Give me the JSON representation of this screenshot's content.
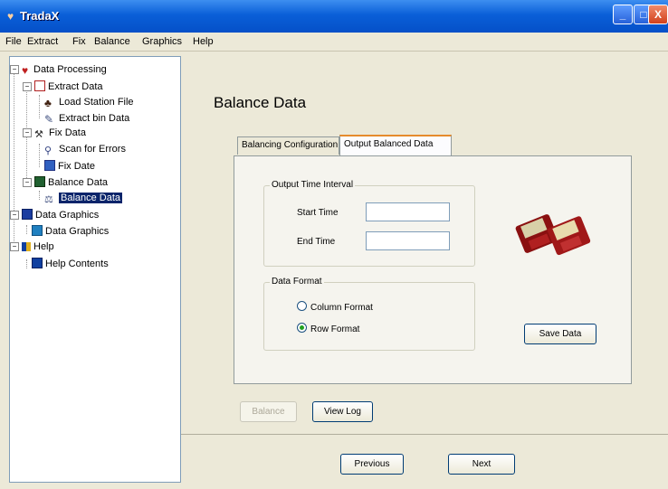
{
  "window": {
    "title": "TradaX",
    "minimize_glyph": "_",
    "maximize_glyph": "□",
    "close_glyph": "X",
    "icon": "app-icon"
  },
  "menu": [
    "File",
    "Extract",
    "Fix",
    "Balance",
    "Graphics",
    "Help"
  ],
  "tree": {
    "data_processing": "Data Processing",
    "extract_data": "Extract Data",
    "load_station_file": "Load Station File",
    "extract_bin_data": "Extract bin Data",
    "fix_data": "Fix Data",
    "scan_for_errors": "Scan for Errors",
    "fix_date": "Fix Date",
    "balance_data": "Balance Data",
    "balance_data_child": "Balance Data",
    "data_graphics": "Data Graphics",
    "data_graphics_child": "Data Graphics",
    "help": "Help",
    "help_contents": "Help Contents"
  },
  "main": {
    "title": "Balance Data",
    "tabs": [
      "Balancing Configuration",
      "Output Balanced Data"
    ],
    "output_interval": {
      "legend": "Output Time Interval",
      "start_label": "Start Time",
      "end_label": "End Time",
      "start_value": "",
      "end_value": ""
    },
    "data_format": {
      "legend": "Data Format",
      "options": [
        "Column Format",
        "Row Format"
      ],
      "selected": "Row Format"
    },
    "save_button": "Save Data",
    "balance_button": "Balance",
    "view_log_button": "View Log",
    "previous_button": "Previous",
    "next_button": "Next"
  },
  "colors": {
    "titlebar": "#0a5fd8",
    "selection": "#0a246a",
    "tab_highlight": "#e68b2c"
  }
}
